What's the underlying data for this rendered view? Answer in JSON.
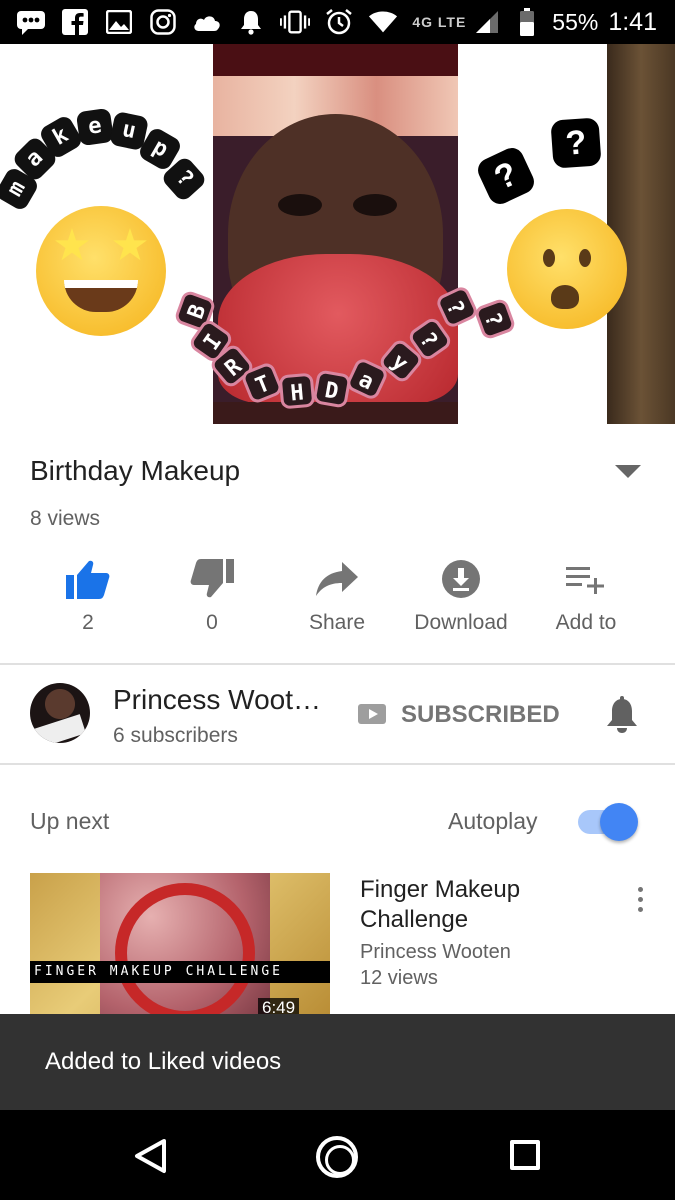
{
  "status_bar": {
    "network": "4G LTE",
    "battery": "55%",
    "time": "1:41",
    "icons": [
      "messages-icon",
      "facebook-icon",
      "gallery-icon",
      "instagram-icon",
      "cloud-icon",
      "notification-bell-icon",
      "vibrate-icon",
      "alarm-icon",
      "wifi-icon",
      "signal-icon",
      "battery-icon"
    ]
  },
  "video": {
    "overlay_text_top": "makeup",
    "overlay_text_bottom": "birthday",
    "question_marks": [
      "?",
      "?",
      "?",
      "?"
    ]
  },
  "video_info": {
    "title": "Birthday Makeup",
    "views": "8 views"
  },
  "actions": [
    {
      "id": "like",
      "label": "2",
      "icon": "thumbs-up-icon",
      "active": true
    },
    {
      "id": "dislike",
      "label": "0",
      "icon": "thumbs-down-icon"
    },
    {
      "id": "share",
      "label": "Share",
      "icon": "share-icon"
    },
    {
      "id": "download",
      "label": "Download",
      "icon": "download-icon"
    },
    {
      "id": "add_to",
      "label": "Add to",
      "icon": "add-to-playlist-icon"
    }
  ],
  "channel": {
    "name": "Princess Woot…",
    "subscribers": "6 subscribers",
    "subscribe_label": "SUBSCRIBED"
  },
  "up_next": {
    "label": "Up next",
    "autoplay_label": "Autoplay",
    "autoplay_on": true,
    "item": {
      "title": "Finger Makeup Challenge",
      "channel": "Princess Wooten",
      "views": "12 views",
      "duration": "6:49",
      "thumb_text": "FINGER MAKEUP CHALLENGE"
    }
  },
  "snackbar": {
    "text": "Added to Liked videos"
  },
  "colors": {
    "accent_blue": "#1a73e8",
    "toggle_blue": "#4285f4",
    "snackbar_bg": "#323232"
  }
}
